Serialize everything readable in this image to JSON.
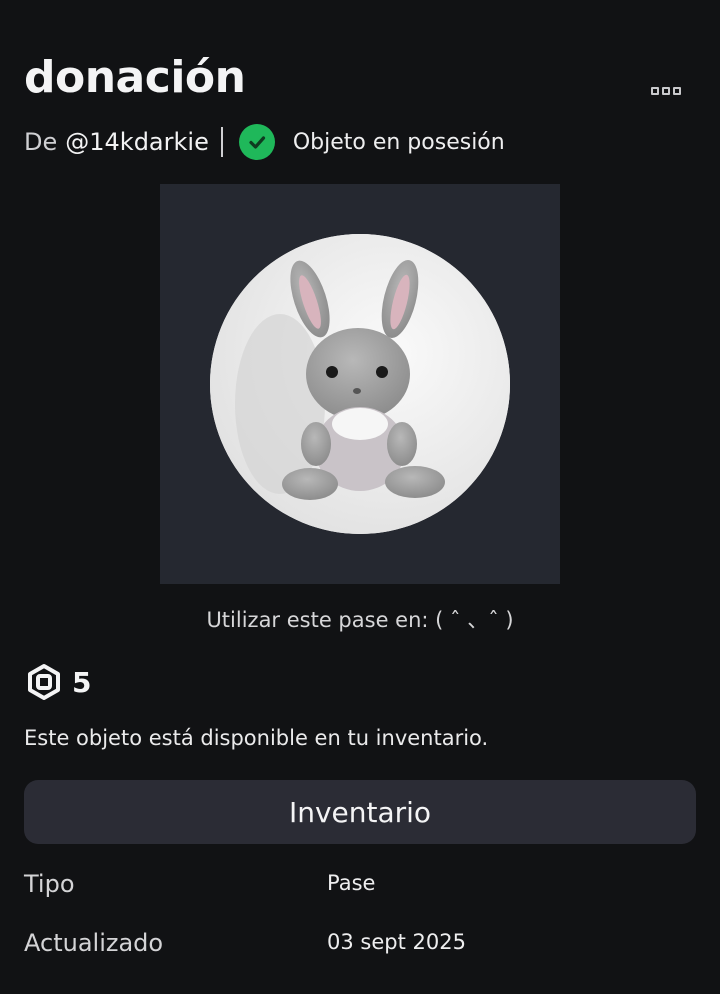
{
  "item": {
    "title": "donación",
    "creator_prefix": "De",
    "creator": "@14kdarkie",
    "owned_status": "Objeto en posesión",
    "use_in": "Utilizar este pase en: ( ˆ 、ˆ )",
    "price": "5",
    "availability_note": "Este objeto está disponible en tu inventario.",
    "inventory_button": "Inventario"
  },
  "details": [
    {
      "label": "Tipo",
      "value": "Pase"
    },
    {
      "label": "Actualizado",
      "value": "03 sept 2025"
    }
  ],
  "icons": {
    "more": "more-options-icon",
    "owned": "checkmark-circle-icon",
    "currency": "robux-icon"
  },
  "colors": {
    "background": "#111214",
    "owned_green": "#1fb85a",
    "button_bg": "#2b2c35",
    "thumbnail_bg": "#252830"
  }
}
